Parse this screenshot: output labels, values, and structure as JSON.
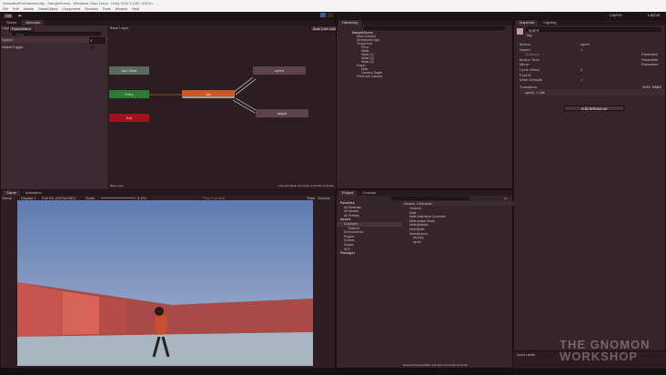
{
  "window": {
    "title": "AnimationForGamesUnity - SampleScene - Windows, Mac, Linux - Unity 2022.3.12f1 <DX11>"
  },
  "menu": [
    "File",
    "Edit",
    "Assets",
    "GameObject",
    "Component",
    "Services",
    "Tools",
    "Window",
    "Help"
  ],
  "toolbar": {
    "account": "AN",
    "layers": "Layers",
    "layout": "Layout"
  },
  "animator": {
    "tabs": [
      "Scene",
      "Animator"
    ],
    "sub_tabs": [
      "Layers",
      "Parameters"
    ],
    "search_placeholder": "Name",
    "parameters": [
      {
        "name": "Speed",
        "value": "0"
      },
      {
        "name": "AttackTrigger",
        "value": ""
      }
    ],
    "layer": "Base Layer",
    "auto_live_link": "Auto Live Link",
    "nodes": {
      "any": "Any State",
      "entry": "Entry",
      "exit": "Exit",
      "idle": "idle",
      "sprint": "sprint",
      "attack": "attack"
    },
    "footer_left": "Base Layer",
    "footer_right": "Character/Male Animation Controller.controller"
  },
  "hierarchy": {
    "tab": "Hierarchy",
    "items": [
      {
        "label": "SampleScene",
        "depth": 0
      },
      {
        "label": "Main Camera",
        "depth": 1
      },
      {
        "label": "Directional Light",
        "depth": 1
      },
      {
        "label": "TempLevel",
        "depth": 1
      },
      {
        "label": "Floor",
        "depth": 2
      },
      {
        "label": "Walls",
        "depth": 2
      },
      {
        "label": "Walls (1)",
        "depth": 2
      },
      {
        "label": "Walls (2)",
        "depth": 2
      },
      {
        "label": "Walls (3)",
        "depth": 2
      },
      {
        "label": "Player",
        "depth": 1
      },
      {
        "label": "Male",
        "depth": 2
      },
      {
        "label": "Camera Target",
        "depth": 2
      },
      {
        "label": "FreeLook Camera",
        "depth": 1
      }
    ]
  },
  "inspector": {
    "tabs": [
      "Inspector",
      "Lighting"
    ],
    "name": "sprint",
    "tag": "Tag",
    "props": [
      {
        "label": "Motion",
        "value": "sprint"
      },
      {
        "label": "Speed",
        "value": "1"
      },
      {
        "label": "Multiplier",
        "value": "Parameter"
      },
      {
        "label": "Motion Time",
        "value": "Parameter"
      },
      {
        "label": "Mirror",
        "value": "Parameter"
      },
      {
        "label": "Cycle Offset",
        "value": "0"
      },
      {
        "label": "Foot IK",
        "value": ""
      },
      {
        "label": "Write Defaults",
        "value": "✓"
      }
    ],
    "cycle_param": "Parameter",
    "transitions_label": "Transitions",
    "solo": "Solo",
    "mute": "Mute",
    "transition": "sprint -> idle",
    "add_behaviour": "Add Behaviour",
    "asset_labels": "Asset Labels"
  },
  "game": {
    "tabs": [
      "Game",
      "Animation"
    ],
    "mode": "Game",
    "display": "Display 1",
    "resolution": "Full HD (1920x1080)",
    "scale_label": "Scale",
    "scale_value": "0.47x",
    "play_focused": "Play Focused",
    "stats": "Stats",
    "gizmos": "Gizmos"
  },
  "project": {
    "tabs": [
      "Project",
      "Console"
    ],
    "favorites": "Favorites",
    "fav_items": [
      "All Materials",
      "All Models",
      "All Prefabs"
    ],
    "assets": "Assets",
    "tree": [
      "Character",
      "Textures",
      "Environments",
      "Plugins",
      "Scenes",
      "Scripts",
      "SFX"
    ],
    "packages": "Packages",
    "breadcrumb": [
      "Assets",
      "Character"
    ],
    "files": [
      "Textures",
      "Male",
      "Male Animation Controller",
      "Male Avatar Mask",
      "Male@attack",
      "Male@idle",
      "Male@sprint",
      "pix.png",
      "sprint"
    ],
    "footer_path": "Assets/Character/Male Animation Controller.controller",
    "count": "13"
  },
  "watermark": "THE GNOMON WORKSHOP",
  "colors": {
    "accent": "#d0581e",
    "entry": "#2d7a34",
    "exit": "#a0121e",
    "state": "#5e4250"
  }
}
